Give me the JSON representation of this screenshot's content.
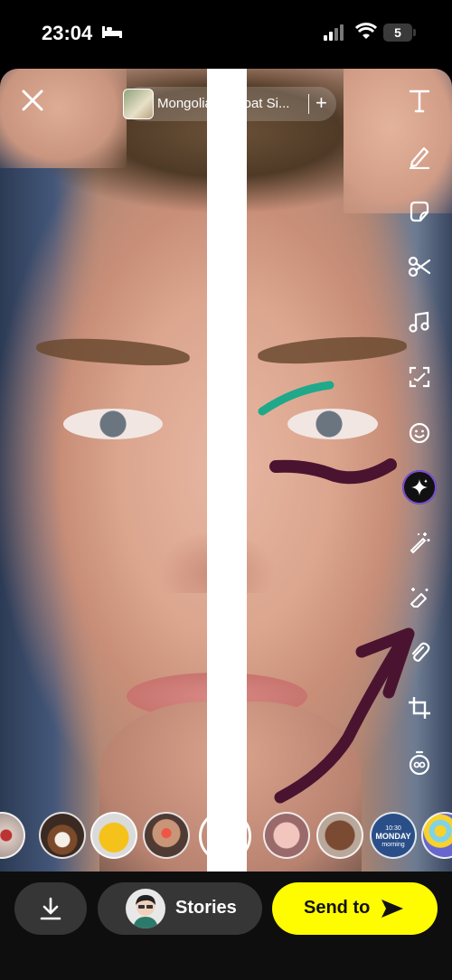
{
  "status_bar": {
    "time": "23:04",
    "battery": "5"
  },
  "sound": {
    "title": "Mongolian Throat Si...",
    "add": "+"
  },
  "tools": [
    {
      "icon": "text-icon"
    },
    {
      "icon": "pencil-icon"
    },
    {
      "icon": "sticker-icon"
    },
    {
      "icon": "scissors-icon"
    },
    {
      "icon": "music-icon"
    },
    {
      "icon": "scan-icon"
    },
    {
      "icon": "emoji-icon"
    },
    {
      "icon": "ai-sparkle-icon"
    },
    {
      "icon": "magic-wand-icon"
    },
    {
      "icon": "eraser-sparkle-icon"
    },
    {
      "icon": "paperclip-icon"
    },
    {
      "icon": "crop-icon"
    },
    {
      "icon": "timer-icon"
    }
  ],
  "lenses": {
    "monday_lens": {
      "time": "10:30",
      "day": "MONDAY",
      "sub": "morning"
    }
  },
  "bottom_bar": {
    "stories_label": "Stories",
    "send_label": "Send to"
  },
  "colors": {
    "send_button": "#fffc00",
    "draw_teal": "#1fa98a",
    "draw_purple": "#4a1430",
    "pill_dark": "#363636"
  }
}
